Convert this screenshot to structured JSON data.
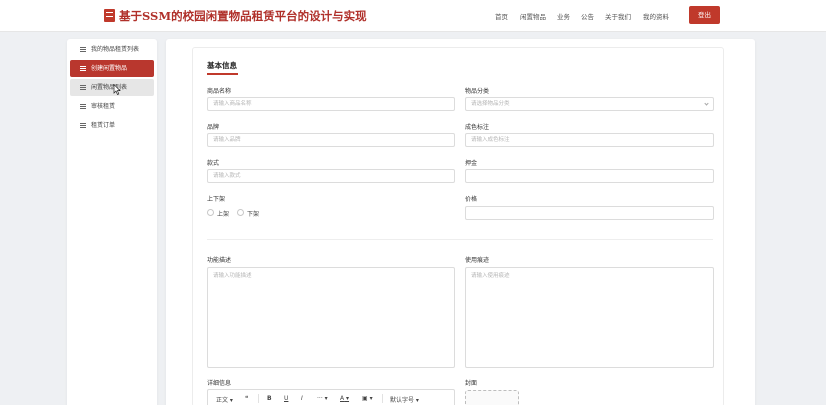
{
  "header": {
    "title": "基于SSM的校园闲置物品租赁平台的设计与实现",
    "nav": [
      "首页",
      "闲置物品",
      "业务",
      "公告",
      "关于我们",
      "我的资料"
    ],
    "login_label": "登出",
    "accent": "#c0392b"
  },
  "sidebar": {
    "items": [
      {
        "label": "我的物品租赁列表",
        "icon": "menu-icon"
      },
      {
        "label": "创建闲置物品",
        "icon": "menu-icon",
        "active": true
      },
      {
        "label": "闲置物品列表",
        "icon": "menu-icon",
        "hover": true
      },
      {
        "label": "审核租赁",
        "icon": "menu-icon"
      },
      {
        "label": "租赁订单",
        "icon": "menu-icon"
      }
    ]
  },
  "form": {
    "section_title": "基本信息",
    "name": {
      "label": "商品名称",
      "placeholder": "请输入商品名称"
    },
    "category": {
      "label": "物品分类",
      "placeholder": "请选择物品分类"
    },
    "brand": {
      "label": "品牌",
      "placeholder": "请输入品牌"
    },
    "condition": {
      "label": "成色标注",
      "placeholder": "请输入成色标注"
    },
    "style": {
      "label": "款式",
      "placeholder": "请输入款式"
    },
    "deposit": {
      "label": "押金",
      "placeholder": ""
    },
    "listing": {
      "label": "上下架",
      "options": [
        "上架",
        "下架"
      ]
    },
    "price": {
      "label": "价格",
      "placeholder": ""
    },
    "description": {
      "label": "功能描述",
      "placeholder": "请输入功能描述"
    },
    "usage": {
      "label": "使用痕迹",
      "placeholder": "请输入使用痕迹"
    },
    "details": {
      "label": "详细信息"
    },
    "cover": {
      "label": "封面"
    }
  },
  "editor_toolbar": {
    "paragraph": "正文",
    "quote": "❝",
    "bold": "B",
    "underline": "U",
    "italic": "I",
    "more": "···",
    "color": "A",
    "image": "▣",
    "font_size": "默认字号"
  }
}
